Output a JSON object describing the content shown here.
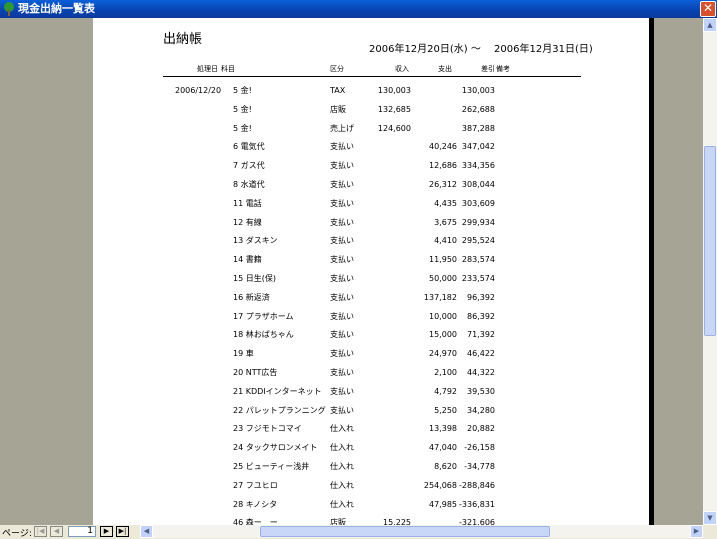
{
  "window": {
    "title": "現金出納一覧表",
    "close_label": "✕"
  },
  "report": {
    "title": "出納帳",
    "date_range": "2006年12月20日(水) ～　 2006年12月31日(日)",
    "headers": {
      "date": "処理日",
      "item": "科目",
      "kind": "区分",
      "income": "収入",
      "expense": "支出",
      "balance": "差引",
      "note": "備考"
    }
  },
  "rows": [
    {
      "date": "2006/12/20",
      "item": "5 金!",
      "kind": "TAX",
      "income": "130,003",
      "expense": "",
      "balance": "130,003"
    },
    {
      "date": "",
      "item": "5 金!",
      "kind": "店販",
      "income": "132,685",
      "expense": "",
      "balance": "262,688"
    },
    {
      "date": "",
      "item": "5 金!",
      "kind": "売上げ",
      "income": "124,600",
      "expense": "",
      "balance": "387,288"
    },
    {
      "date": "",
      "item": "6 電気代",
      "kind": "支払い",
      "income": "",
      "expense": "40,246",
      "balance": "347,042"
    },
    {
      "date": "",
      "item": "7 ガス代",
      "kind": "支払い",
      "income": "",
      "expense": "12,686",
      "balance": "334,356"
    },
    {
      "date": "",
      "item": "8 水道代",
      "kind": "支払い",
      "income": "",
      "expense": "26,312",
      "balance": "308,044"
    },
    {
      "date": "",
      "item": "11 電話",
      "kind": "支払い",
      "income": "",
      "expense": "4,435",
      "balance": "303,609"
    },
    {
      "date": "",
      "item": "12 有線",
      "kind": "支払い",
      "income": "",
      "expense": "3,675",
      "balance": "299,934"
    },
    {
      "date": "",
      "item": "13 ダスキン",
      "kind": "支払い",
      "income": "",
      "expense": "4,410",
      "balance": "295,524"
    },
    {
      "date": "",
      "item": "14 書籍",
      "kind": "支払い",
      "income": "",
      "expense": "11,950",
      "balance": "283,574"
    },
    {
      "date": "",
      "item": "15 日生(保)",
      "kind": "支払い",
      "income": "",
      "expense": "50,000",
      "balance": "233,574"
    },
    {
      "date": "",
      "item": "16 新返済",
      "kind": "支払い",
      "income": "",
      "expense": "137,182",
      "balance": "96,392"
    },
    {
      "date": "",
      "item": "17 プラザホーム",
      "kind": "支払い",
      "income": "",
      "expense": "10,000",
      "balance": "86,392"
    },
    {
      "date": "",
      "item": "18 林おばちゃん",
      "kind": "支払い",
      "income": "",
      "expense": "15,000",
      "balance": "71,392"
    },
    {
      "date": "",
      "item": "19 車",
      "kind": "支払い",
      "income": "",
      "expense": "24,970",
      "balance": "46,422"
    },
    {
      "date": "",
      "item": "20 NTT広告",
      "kind": "支払い",
      "income": "",
      "expense": "2,100",
      "balance": "44,322"
    },
    {
      "date": "",
      "item": "21 KDDIインターネット",
      "kind": "支払い",
      "income": "",
      "expense": "4,792",
      "balance": "39,530"
    },
    {
      "date": "",
      "item": "22 パレットプランニング",
      "kind": "支払い",
      "income": "",
      "expense": "5,250",
      "balance": "34,280"
    },
    {
      "date": "",
      "item": "23 フジモトコマイ",
      "kind": "仕入れ",
      "income": "",
      "expense": "13,398",
      "balance": "20,882"
    },
    {
      "date": "",
      "item": "24 タックサロンメイト",
      "kind": "仕入れ",
      "income": "",
      "expense": "47,040",
      "balance": "-26,158"
    },
    {
      "date": "",
      "item": "25 ビューティー浅井",
      "kind": "仕入れ",
      "income": "",
      "expense": "8,620",
      "balance": "-34,778"
    },
    {
      "date": "",
      "item": "27 フユヒロ",
      "kind": "仕入れ",
      "income": "",
      "expense": "254,068",
      "balance": "-288,846"
    },
    {
      "date": "",
      "item": "28 キノシタ",
      "kind": "仕入れ",
      "income": "",
      "expense": "47,985",
      "balance": "-336,831"
    },
    {
      "date": "",
      "item": "46 森ー　ー",
      "kind": "店販",
      "income": "15,225",
      "expense": "",
      "balance": "-321,606"
    }
  ],
  "status": {
    "page_label": "ページ:",
    "page_value": "1"
  },
  "icons": {
    "first": "first-page-icon",
    "prev": "prev-page-icon",
    "next": "next-page-icon",
    "last": "last-page-icon"
  }
}
